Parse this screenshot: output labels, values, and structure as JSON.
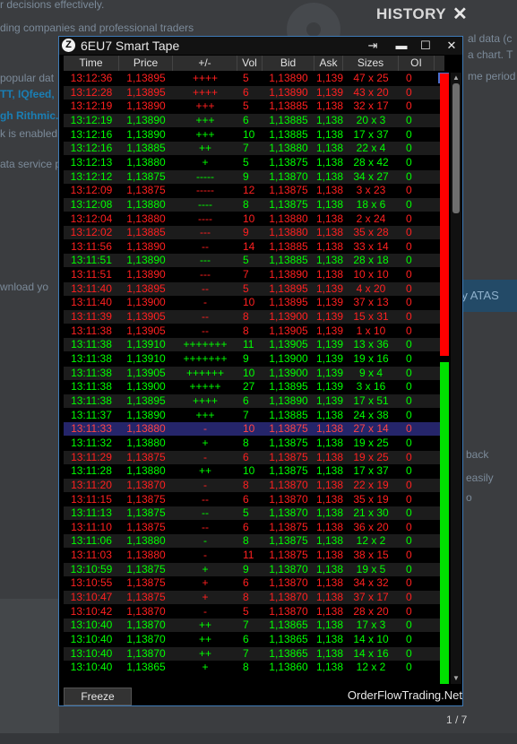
{
  "background": {
    "texts": [
      {
        "t": "r decisions effectively.",
        "cls": ""
      },
      {
        "t": "ding companies and professional traders",
        "cls": ""
      },
      {
        "t": "al data (c",
        "cls": ""
      },
      {
        "t": "a chart. T",
        "cls": ""
      },
      {
        "t": "popular dat",
        "cls": ""
      },
      {
        "t": "TT, IQfeed,",
        "cls": "blue"
      },
      {
        "t": "me period",
        "cls": ""
      },
      {
        "t": "gh Rithmic.",
        "cls": "blue"
      },
      {
        "t": "k is enabled",
        "cls": ""
      },
      {
        "t": "ata service p",
        "cls": ""
      },
      {
        "t": "wnload yo",
        "cls": ""
      },
      {
        "t": "back",
        "cls": ""
      },
      {
        "t": "easily",
        "cls": ""
      },
      {
        "t": "o",
        "cls": ""
      }
    ],
    "history_title": "HISTORY",
    "close_glyph": "✕",
    "try_button": "ry ATAS",
    "pager": "1 / 7"
  },
  "window": {
    "title": "6EU7 Smart Tape",
    "icon_glyph": "Z",
    "pin_glyph": "⇥",
    "minimize_glyph": "▬",
    "maximize_glyph": "☐",
    "close_glyph": "✕",
    "freeze_label": "Freeze",
    "brand": "OrderFlowTrading.Net"
  },
  "columns": [
    "Time",
    "Price",
    "+/-",
    "Vol",
    "Bid",
    "Ask",
    "Sizes",
    "OI"
  ],
  "colors": {
    "buy": "#00ff00",
    "sell": "#ff2020"
  },
  "rows": [
    {
      "time": "13:12:36",
      "price": "1,13895",
      "pm": "++++",
      "vol": "5",
      "bid": "1,13890",
      "ask": "1,139",
      "sizes": "47 x 25",
      "oi": "0",
      "side": "sell"
    },
    {
      "time": "13:12:28",
      "price": "1,13895",
      "pm": "++++",
      "vol": "6",
      "bid": "1,13890",
      "ask": "1,139",
      "sizes": "43 x 20",
      "oi": "0",
      "side": "sell"
    },
    {
      "time": "13:12:19",
      "price": "1,13890",
      "pm": "+++",
      "vol": "5",
      "bid": "1,13885",
      "ask": "1,138",
      "sizes": "32 x 17",
      "oi": "0",
      "side": "sell"
    },
    {
      "time": "13:12:19",
      "price": "1,13890",
      "pm": "+++",
      "vol": "6",
      "bid": "1,13885",
      "ask": "1,138",
      "sizes": "20 x 3",
      "oi": "0",
      "side": "buy"
    },
    {
      "time": "13:12:16",
      "price": "1,13890",
      "pm": "+++",
      "vol": "10",
      "bid": "1,13885",
      "ask": "1,138",
      "sizes": "17 x 37",
      "oi": "0",
      "side": "buy"
    },
    {
      "time": "13:12:16",
      "price": "1,13885",
      "pm": "++",
      "vol": "7",
      "bid": "1,13880",
      "ask": "1,138",
      "sizes": "22 x 4",
      "oi": "0",
      "side": "buy"
    },
    {
      "time": "13:12:13",
      "price": "1,13880",
      "pm": "+",
      "vol": "5",
      "bid": "1,13875",
      "ask": "1,138",
      "sizes": "28 x 42",
      "oi": "0",
      "side": "buy"
    },
    {
      "time": "13:12:12",
      "price": "1,13875",
      "pm": "-----",
      "vol": "9",
      "bid": "1,13870",
      "ask": "1,138",
      "sizes": "34 x 27",
      "oi": "0",
      "side": "buy"
    },
    {
      "time": "13:12:09",
      "price": "1,13875",
      "pm": "-----",
      "vol": "12",
      "bid": "1,13875",
      "ask": "1,138",
      "sizes": "3 x 23",
      "oi": "0",
      "side": "sell"
    },
    {
      "time": "13:12:08",
      "price": "1,13880",
      "pm": "----",
      "vol": "8",
      "bid": "1,13875",
      "ask": "1,138",
      "sizes": "18 x 6",
      "oi": "0",
      "side": "buy"
    },
    {
      "time": "13:12:04",
      "price": "1,13880",
      "pm": "----",
      "vol": "10",
      "bid": "1,13880",
      "ask": "1,138",
      "sizes": "2 x 24",
      "oi": "0",
      "side": "sell"
    },
    {
      "time": "13:12:02",
      "price": "1,13885",
      "pm": "---",
      "vol": "9",
      "bid": "1,13880",
      "ask": "1,138",
      "sizes": "35 x 28",
      "oi": "0",
      "side": "sell"
    },
    {
      "time": "13:11:56",
      "price": "1,13890",
      "pm": "--",
      "vol": "14",
      "bid": "1,13885",
      "ask": "1,138",
      "sizes": "33 x 14",
      "oi": "0",
      "side": "sell"
    },
    {
      "time": "13:11:51",
      "price": "1,13890",
      "pm": "---",
      "vol": "5",
      "bid": "1,13885",
      "ask": "1,138",
      "sizes": "28 x 18",
      "oi": "0",
      "side": "buy"
    },
    {
      "time": "13:11:51",
      "price": "1,13890",
      "pm": "---",
      "vol": "7",
      "bid": "1,13890",
      "ask": "1,138",
      "sizes": "10 x 10",
      "oi": "0",
      "side": "sell"
    },
    {
      "time": "13:11:40",
      "price": "1,13895",
      "pm": "--",
      "vol": "5",
      "bid": "1,13895",
      "ask": "1,139",
      "sizes": "4 x 20",
      "oi": "0",
      "side": "sell"
    },
    {
      "time": "13:11:40",
      "price": "1,13900",
      "pm": "-",
      "vol": "10",
      "bid": "1,13895",
      "ask": "1,139",
      "sizes": "37 x 13",
      "oi": "0",
      "side": "sell"
    },
    {
      "time": "13:11:39",
      "price": "1,13905",
      "pm": "--",
      "vol": "8",
      "bid": "1,13900",
      "ask": "1,139",
      "sizes": "15 x 31",
      "oi": "0",
      "side": "sell"
    },
    {
      "time": "13:11:38",
      "price": "1,13905",
      "pm": "--",
      "vol": "8",
      "bid": "1,13905",
      "ask": "1,139",
      "sizes": "1 x 10",
      "oi": "0",
      "side": "sell"
    },
    {
      "time": "13:11:38",
      "price": "1,13910",
      "pm": "+++++++",
      "vol": "11",
      "bid": "1,13905",
      "ask": "1,139",
      "sizes": "13 x 36",
      "oi": "0",
      "side": "buy"
    },
    {
      "time": "13:11:38",
      "price": "1,13910",
      "pm": "+++++++",
      "vol": "9",
      "bid": "1,13900",
      "ask": "1,139",
      "sizes": "19 x 16",
      "oi": "0",
      "side": "buy"
    },
    {
      "time": "13:11:38",
      "price": "1,13905",
      "pm": "++++++",
      "vol": "10",
      "bid": "1,13900",
      "ask": "1,139",
      "sizes": "9 x 4",
      "oi": "0",
      "side": "buy"
    },
    {
      "time": "13:11:38",
      "price": "1,13900",
      "pm": "+++++",
      "vol": "27",
      "bid": "1,13895",
      "ask": "1,139",
      "sizes": "3 x 16",
      "oi": "0",
      "side": "buy"
    },
    {
      "time": "13:11:38",
      "price": "1,13895",
      "pm": "++++",
      "vol": "6",
      "bid": "1,13890",
      "ask": "1,139",
      "sizes": "17 x 51",
      "oi": "0",
      "side": "buy"
    },
    {
      "time": "13:11:37",
      "price": "1,13890",
      "pm": "+++",
      "vol": "7",
      "bid": "1,13885",
      "ask": "1,138",
      "sizes": "24 x 38",
      "oi": "0",
      "side": "buy"
    },
    {
      "time": "13:11:33",
      "price": "1,13880",
      "pm": "-",
      "vol": "10",
      "bid": "1,13875",
      "ask": "1,138",
      "sizes": "27 x 14",
      "oi": "0",
      "side": "sell",
      "selected": true
    },
    {
      "time": "13:11:32",
      "price": "1,13880",
      "pm": "+",
      "vol": "8",
      "bid": "1,13875",
      "ask": "1,138",
      "sizes": "19 x 25",
      "oi": "0",
      "side": "buy"
    },
    {
      "time": "13:11:29",
      "price": "1,13875",
      "pm": "-",
      "vol": "6",
      "bid": "1,13875",
      "ask": "1,138",
      "sizes": "19 x 25",
      "oi": "0",
      "side": "sell"
    },
    {
      "time": "13:11:28",
      "price": "1,13880",
      "pm": "++",
      "vol": "10",
      "bid": "1,13875",
      "ask": "1,138",
      "sizes": "17 x 37",
      "oi": "0",
      "side": "buy"
    },
    {
      "time": "13:11:20",
      "price": "1,13870",
      "pm": "-",
      "vol": "8",
      "bid": "1,13870",
      "ask": "1,138",
      "sizes": "22 x 19",
      "oi": "0",
      "side": "sell"
    },
    {
      "time": "13:11:15",
      "price": "1,13875",
      "pm": "--",
      "vol": "6",
      "bid": "1,13870",
      "ask": "1,138",
      "sizes": "35 x 19",
      "oi": "0",
      "side": "sell"
    },
    {
      "time": "13:11:13",
      "price": "1,13875",
      "pm": "--",
      "vol": "5",
      "bid": "1,13870",
      "ask": "1,138",
      "sizes": "21 x 30",
      "oi": "0",
      "side": "buy"
    },
    {
      "time": "13:11:10",
      "price": "1,13875",
      "pm": "--",
      "vol": "6",
      "bid": "1,13875",
      "ask": "1,138",
      "sizes": "36 x 20",
      "oi": "0",
      "side": "sell"
    },
    {
      "time": "13:11:06",
      "price": "1,13880",
      "pm": "-",
      "vol": "8",
      "bid": "1,13875",
      "ask": "1,138",
      "sizes": "12 x 2",
      "oi": "0",
      "side": "buy"
    },
    {
      "time": "13:11:03",
      "price": "1,13880",
      "pm": "-",
      "vol": "11",
      "bid": "1,13875",
      "ask": "1,138",
      "sizes": "38 x 15",
      "oi": "0",
      "side": "sell"
    },
    {
      "time": "13:10:59",
      "price": "1,13875",
      "pm": "+",
      "vol": "9",
      "bid": "1,13870",
      "ask": "1,138",
      "sizes": "19 x 5",
      "oi": "0",
      "side": "buy"
    },
    {
      "time": "13:10:55",
      "price": "1,13875",
      "pm": "+",
      "vol": "6",
      "bid": "1,13870",
      "ask": "1,138",
      "sizes": "34 x 32",
      "oi": "0",
      "side": "sell"
    },
    {
      "time": "13:10:47",
      "price": "1,13875",
      "pm": "+",
      "vol": "8",
      "bid": "1,13870",
      "ask": "1,138",
      "sizes": "37 x 17",
      "oi": "0",
      "side": "sell"
    },
    {
      "time": "13:10:42",
      "price": "1,13870",
      "pm": "-",
      "vol": "5",
      "bid": "1,13870",
      "ask": "1,138",
      "sizes": "28 x 20",
      "oi": "0",
      "side": "sell"
    },
    {
      "time": "13:10:40",
      "price": "1,13870",
      "pm": "++",
      "vol": "7",
      "bid": "1,13865",
      "ask": "1,138",
      "sizes": "17 x 3",
      "oi": "0",
      "side": "buy"
    },
    {
      "time": "13:10:40",
      "price": "1,13870",
      "pm": "++",
      "vol": "6",
      "bid": "1,13865",
      "ask": "1,138",
      "sizes": "14 x 10",
      "oi": "0",
      "side": "buy"
    },
    {
      "time": "13:10:40",
      "price": "1,13870",
      "pm": "++",
      "vol": "7",
      "bid": "1,13865",
      "ask": "1,138",
      "sizes": "14 x 16",
      "oi": "0",
      "side": "buy"
    },
    {
      "time": "13:10:40",
      "price": "1,13865",
      "pm": "+",
      "vol": "8",
      "bid": "1,13860",
      "ask": "1,138",
      "sizes": "12 x 2",
      "oi": "0",
      "side": "buy"
    }
  ]
}
